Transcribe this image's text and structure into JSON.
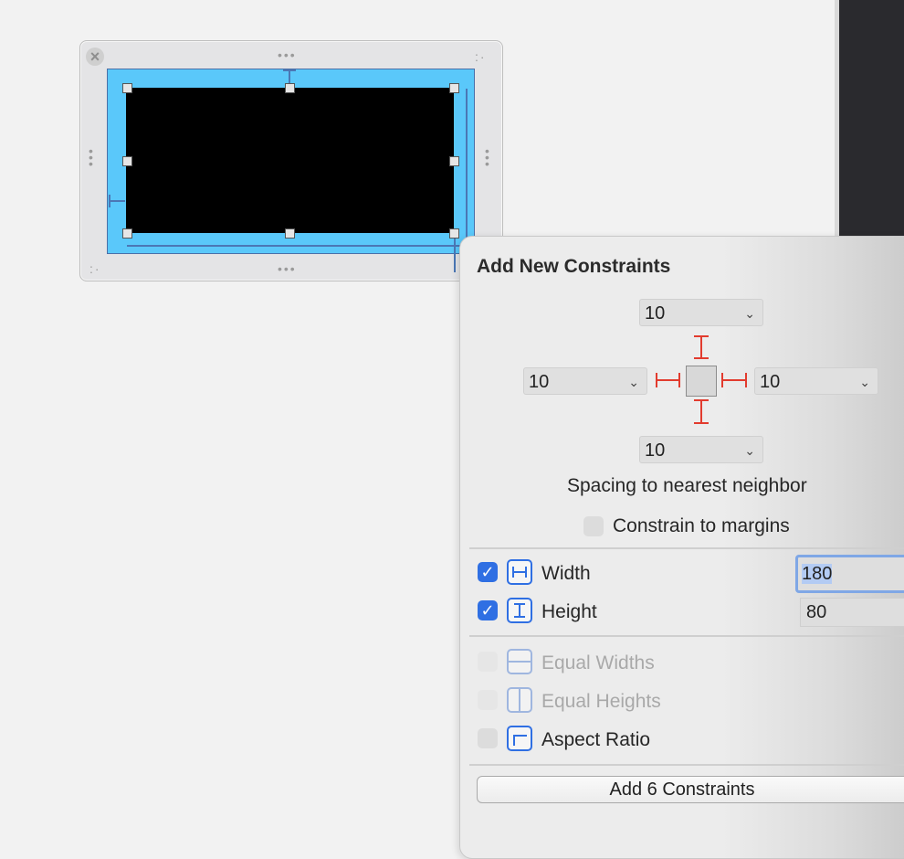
{
  "popover": {
    "title": "Add New Constraints",
    "spacing": {
      "top": "10",
      "left": "10",
      "right": "10",
      "bottom": "10"
    },
    "spacing_caption": "Spacing to nearest neighbor",
    "constrain_to_margins": "Constrain to margins",
    "width": {
      "label": "Width",
      "value": "180",
      "checked": true
    },
    "height": {
      "label": "Height",
      "value": "80",
      "checked": true
    },
    "equal_widths": "Equal Widths",
    "equal_heights": "Equal Heights",
    "aspect_ratio": "Aspect Ratio",
    "add_button": "Add 6 Constraints"
  },
  "colors": {
    "selected_view": "#5ac8fa",
    "checkbox_on": "#2f6fe3",
    "pin_red": "#e23b2e"
  },
  "icons": {
    "close": "close-icon",
    "chevron": "chevron-down-icon"
  }
}
